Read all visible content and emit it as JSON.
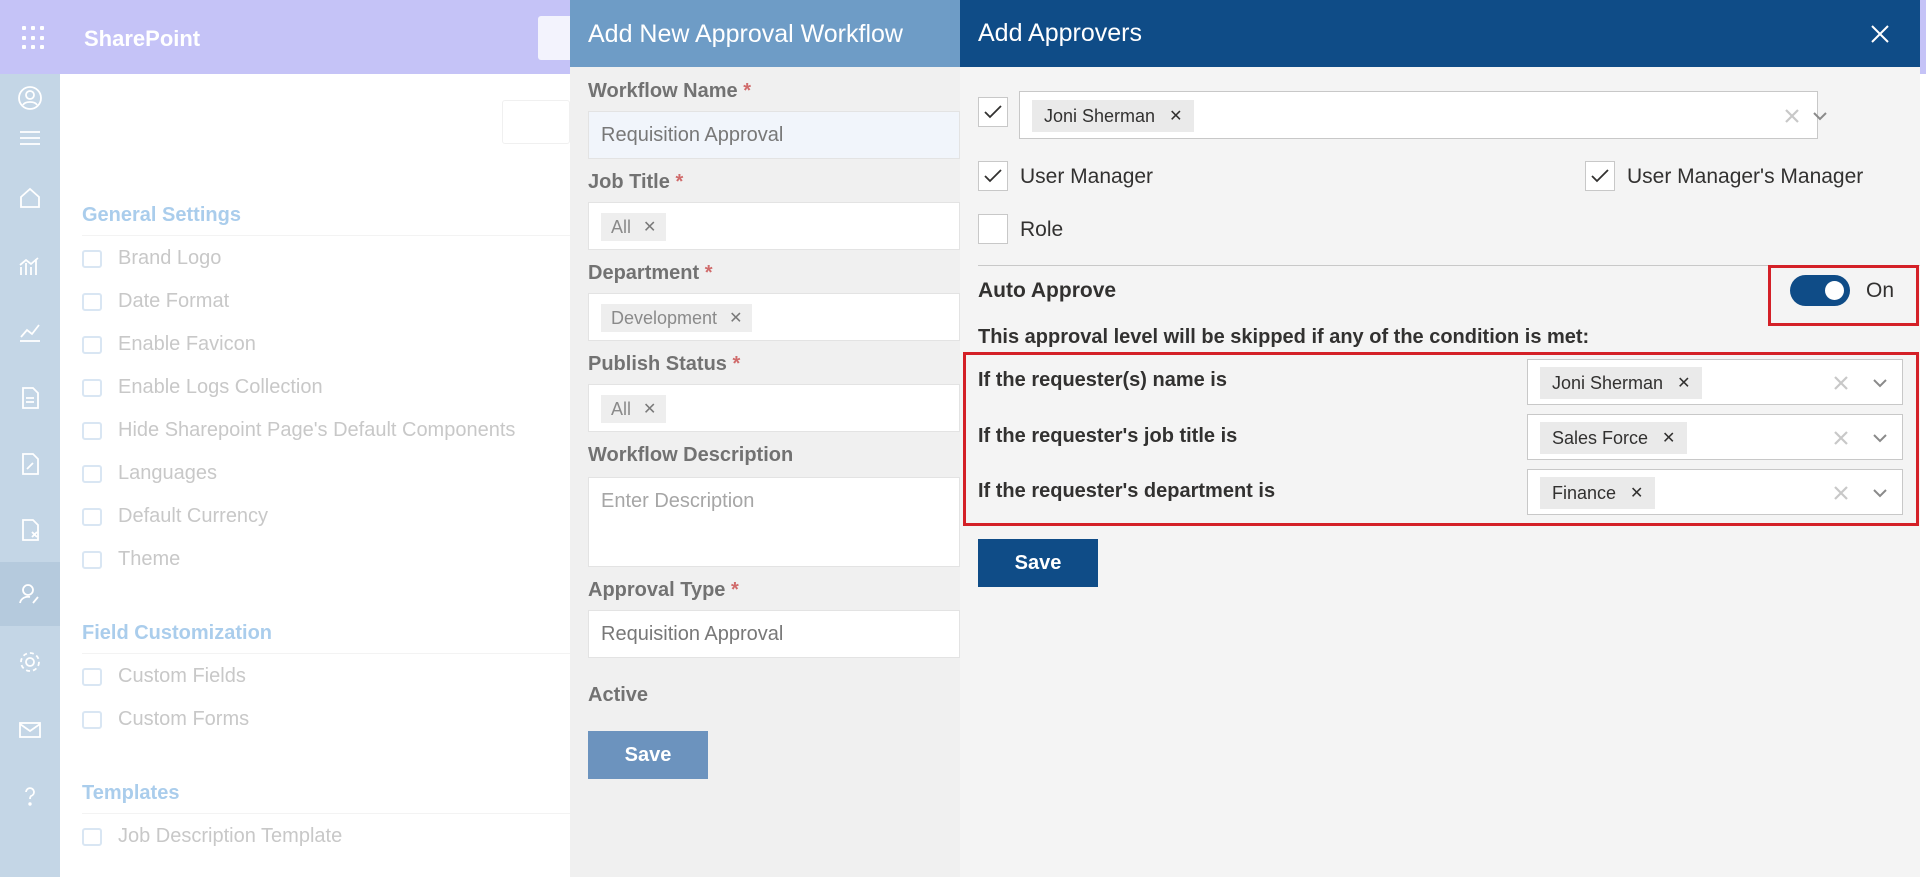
{
  "suite": {
    "app_name": "SharePoint"
  },
  "background": {
    "general_settings": {
      "heading": "General Settings",
      "items": [
        "Brand Logo",
        "Date Format",
        "Enable Favicon",
        "Enable Logs Collection",
        "Hide Sharepoint Page's Default Components",
        "Languages",
        "Default Currency",
        "Theme"
      ]
    },
    "field_customization": {
      "heading": "Field Customization",
      "items": [
        "Custom Fields",
        "Custom Forms"
      ]
    },
    "templates": {
      "heading": "Templates",
      "items": [
        "Job Description Template"
      ]
    }
  },
  "workflow_panel": {
    "title": "Add New Approval Workflow",
    "required_mark": "*",
    "workflow_name": {
      "label": "Workflow Name",
      "value": "Requisition Approval"
    },
    "job_title": {
      "label": "Job Title",
      "tag": "All"
    },
    "department": {
      "label": "Department",
      "tag": "Development"
    },
    "publish_status": {
      "label": "Publish Status",
      "tag": "All"
    },
    "description": {
      "label": "Workflow Description",
      "placeholder": "Enter Description"
    },
    "approval_type": {
      "label": "Approval Type",
      "value": "Requisition Approval"
    },
    "active": {
      "label": "Active"
    },
    "save_label": "Save"
  },
  "approvers_panel": {
    "title": "Add Approvers",
    "approver_picker": {
      "checked": true,
      "selected": "Joni Sherman"
    },
    "user_manager": {
      "label": "User Manager",
      "checked": true
    },
    "user_managers_manager": {
      "label": "User Manager's Manager",
      "checked": true
    },
    "role": {
      "label": "Role",
      "checked": false
    },
    "auto_approve": {
      "label": "Auto Approve",
      "toggle_label": "On",
      "on": true
    },
    "skip_text": "This approval level will be skipped if any of the condition is met:",
    "conditions": [
      {
        "label": "If the requester(s) name is",
        "value": "Joni Sherman"
      },
      {
        "label": "If the requester's job title is",
        "value": "Sales Force"
      },
      {
        "label": "If the requester's department is",
        "value": "Finance"
      }
    ],
    "save_label": "Save",
    "highlight_color": "#d42027",
    "accent_color": "#0f4c87"
  }
}
